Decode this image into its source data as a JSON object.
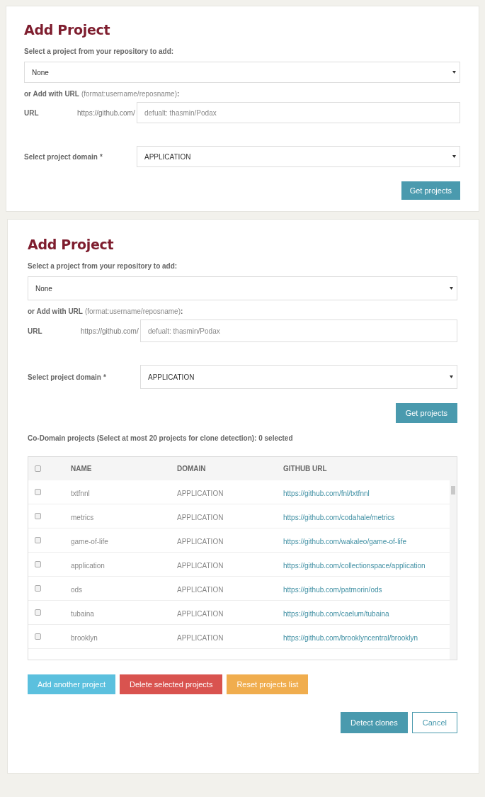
{
  "panels": [
    {
      "title": "Add Project",
      "repo_label": "Select a project from your repository to add:",
      "repo_select": "None",
      "url_heading": "or Add with URL",
      "url_format": "(format:username/reposname)",
      "url_colon": ":",
      "url_label": "URL",
      "url_prefix": "https://github.com/",
      "url_placeholder": "defualt: thasmin/Podax",
      "domain_label": "Select project domain",
      "domain_required": "*",
      "domain_select": "APPLICATION",
      "get_button": "Get projects"
    },
    {
      "title": "Add Project",
      "repo_label": "Select a project from your repository to add:",
      "repo_select": "None",
      "url_heading": "or Add with URL",
      "url_format": "(format:username/reposname)",
      "url_colon": ":",
      "url_label": "URL",
      "url_prefix": "https://github.com/",
      "url_placeholder": "defualt: thasmin/Podax",
      "domain_label": "Select project domain",
      "domain_required": "*",
      "domain_select": "APPLICATION",
      "get_button": "Get projects",
      "codomain_label": "Co-Domain projects (Select at most 20 projects for clone detection): 0 selected",
      "table": {
        "select_all_checked": false,
        "columns": [
          "NAME",
          "DOMAIN",
          "GITHUB URL"
        ],
        "rows": [
          {
            "checked": false,
            "name": "txtfnnl",
            "domain": "APPLICATION",
            "url": "https://github.com/fnl/txtfnnl"
          },
          {
            "checked": false,
            "name": "metrics",
            "domain": "APPLICATION",
            "url": "https://github.com/codahale/metrics"
          },
          {
            "checked": false,
            "name": "game-of-life",
            "domain": "APPLICATION",
            "url": "https://github.com/wakaleo/game-of-life"
          },
          {
            "checked": false,
            "name": "application",
            "domain": "APPLICATION",
            "url": "https://github.com/collectionspace/application"
          },
          {
            "checked": false,
            "name": "ods",
            "domain": "APPLICATION",
            "url": "https://github.com/patmorin/ods"
          },
          {
            "checked": false,
            "name": "tubaina",
            "domain": "APPLICATION",
            "url": "https://github.com/caelum/tubaina"
          },
          {
            "checked": false,
            "name": "brooklyn",
            "domain": "APPLICATION",
            "url": "https://github.com/brooklyncentral/brooklyn"
          }
        ]
      },
      "list_buttons": [
        {
          "kind": "info",
          "label": "Add another project"
        },
        {
          "kind": "danger",
          "label": "Delete selected projects"
        },
        {
          "kind": "warning",
          "label": "Reset projects list"
        }
      ],
      "action_buttons": [
        {
          "kind": "primary",
          "label": "Detect clones"
        },
        {
          "kind": "outline",
          "label": "Cancel"
        }
      ]
    }
  ]
}
